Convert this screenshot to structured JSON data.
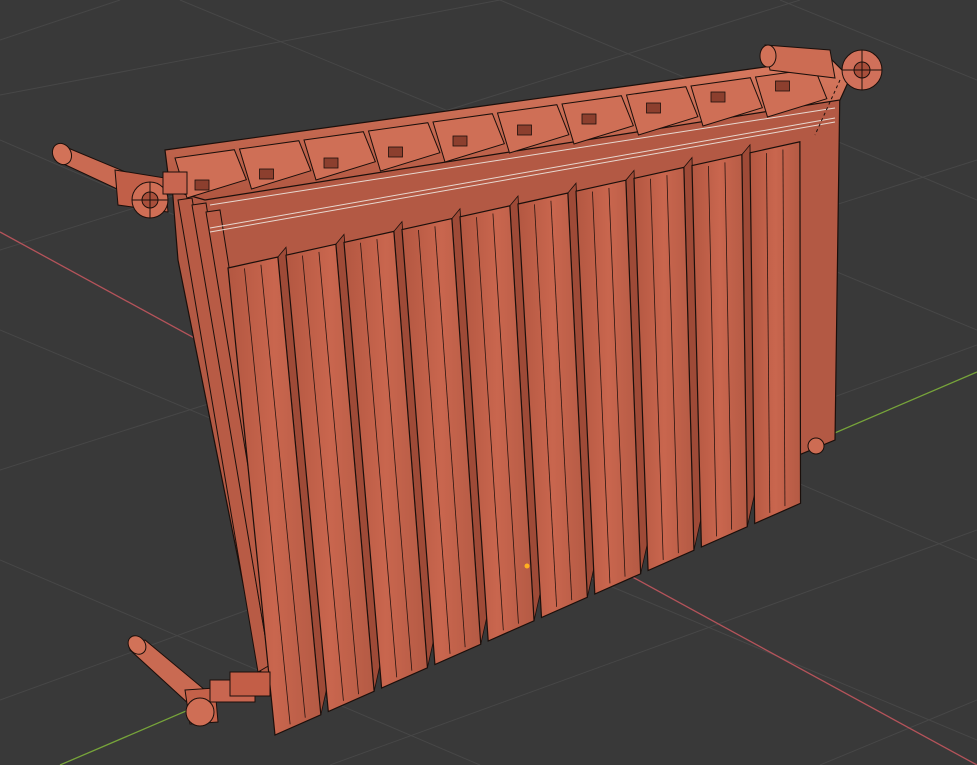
{
  "viewport": {
    "background": "#393939",
    "grid_color": "#4a4a4a",
    "axis_x_color": "#b4535a",
    "axis_y_color": "#77a43a",
    "object": "radiator",
    "edit_mode": true,
    "selection_color": "#c8634d",
    "wire_color": "#1b0f0b"
  },
  "radiator": {
    "section_count": 10,
    "fin_count": 10
  },
  "icons": [
    "valve-knob-left-top",
    "valve-knob-right-top",
    "valve-knob-left-bottom",
    "plug-right-bottom"
  ]
}
